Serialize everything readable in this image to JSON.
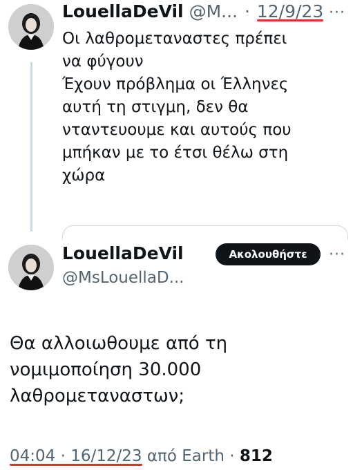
{
  "tweet1": {
    "display_name": "LouellaDeVil",
    "handle": "@M...",
    "separator": "·",
    "date": "12/9/23",
    "text": "Οι λαθρομεταναστες πρέπει\nνα φύγουν\nΈχουν πρόβλημα οι Έλληνες\nαυτή τη στιγμη, δεν θα\nνταντευουμε και αυτούς που\nμπήκαν με το έτσι θέλω στη\nχώρα",
    "more_icon": "···"
  },
  "tweet2": {
    "display_name": "LouellaDeVil",
    "handle": "@MsLouellaD...",
    "follow_label": "Ακολουθήστε",
    "more_icon": "···",
    "text": "Θα αλλοιωθουμε από τη\nνομιμοποίηση 30.000\nλαθρομεταναστων;",
    "time": "04:04",
    "separator": "·",
    "date": "16/12/23",
    "source": "από Earth",
    "separator2": "·",
    "view_count": "812"
  },
  "colors": {
    "text": "#0f1419",
    "secondary": "#536471",
    "underline_annotation": "#e03131",
    "follow_button": "#0f1419"
  }
}
